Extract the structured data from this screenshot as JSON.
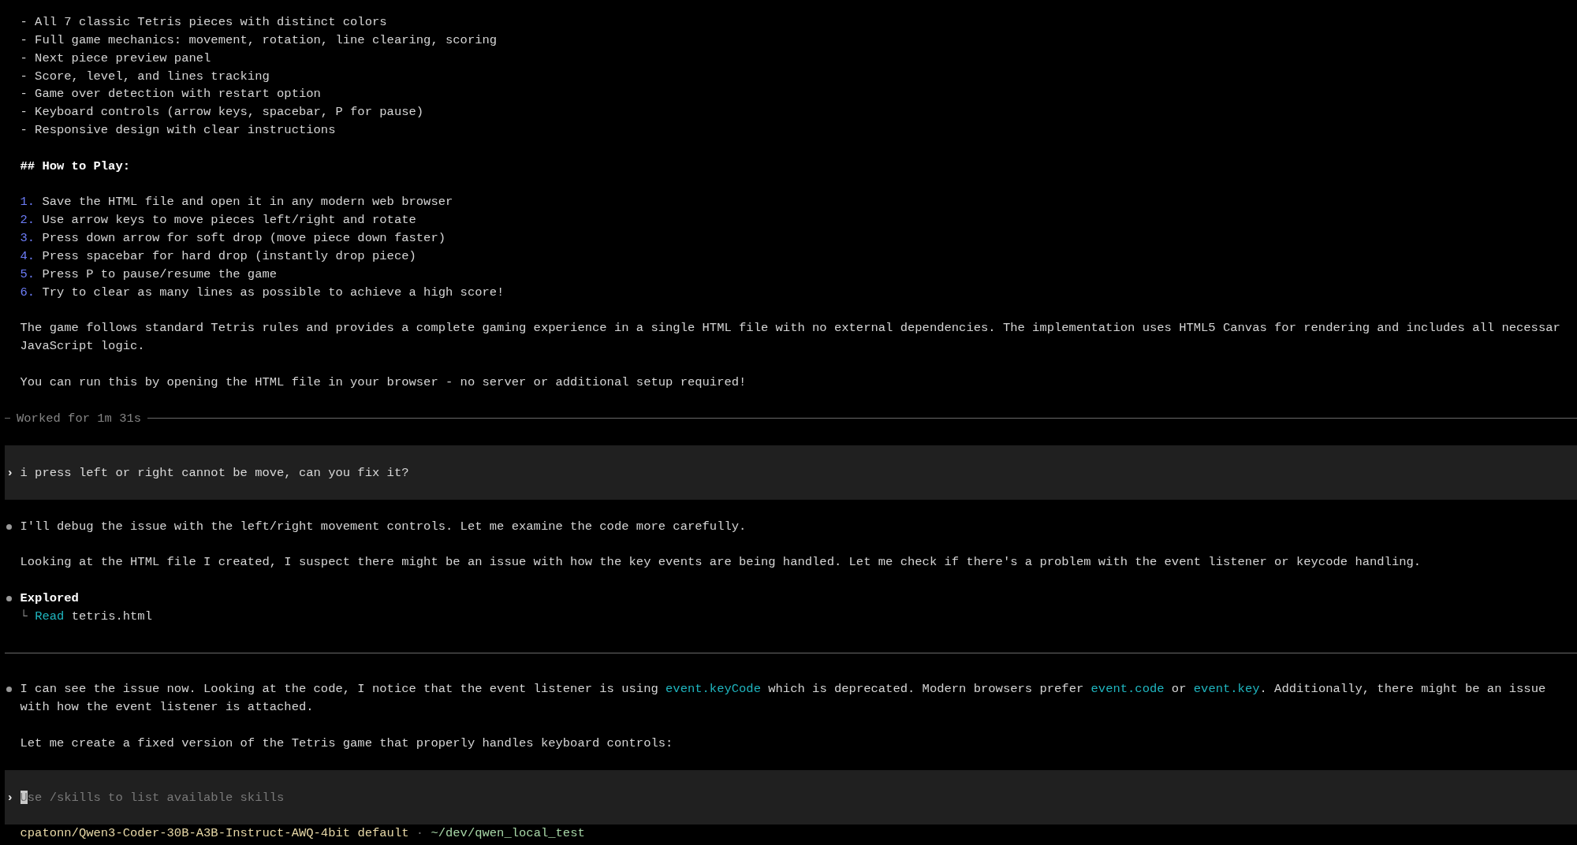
{
  "transcript": [
    {
      "kind": "bullets",
      "items": [
        "- All 7 classic Tetris pieces with distinct colors",
        "- Full game mechanics: movement, rotation, line clearing, scoring",
        "- Next piece preview panel",
        "- Score, level, and lines tracking",
        "- Game over detection with restart option",
        "- Keyboard controls (arrow keys, spacebar, P for pause)",
        "- Responsive design with clear instructions"
      ]
    },
    {
      "kind": "heading",
      "text": "## How to Play:"
    },
    {
      "kind": "numbered",
      "items": [
        {
          "number": "1.",
          "text": "Save the HTML file and open it in any modern web browser"
        },
        {
          "number": "2.",
          "text": "Use arrow keys to move pieces left/right and rotate"
        },
        {
          "number": "3.",
          "text": "Press down arrow for soft drop (move piece down faster)"
        },
        {
          "number": "4.",
          "text": "Press spacebar for hard drop (instantly drop piece)"
        },
        {
          "number": "5.",
          "text": "Press P to pause/resume the game"
        },
        {
          "number": "6.",
          "text": "Try to clear as many lines as possible to achieve a high score!"
        }
      ]
    },
    {
      "kind": "paragraph",
      "bullet": false,
      "lines": [
        [
          {
            "text": "The game follows standard Tetris rules and provides a complete gaming experience in a single HTML file with no external dependencies. The implementation uses HTML5 Canvas for rendering and includes all necessar"
          }
        ],
        [
          {
            "text": "JavaScript logic."
          }
        ]
      ]
    },
    {
      "kind": "paragraph",
      "bullet": false,
      "lines": [
        [
          {
            "text": "You can run this by opening the HTML file in your browser - no server or additional setup required!"
          }
        ]
      ]
    },
    {
      "kind": "worked",
      "text": "Worked for 1m 31s"
    },
    {
      "kind": "user",
      "chevron": "›",
      "text": "i press left or right cannot be move, can you fix it?"
    },
    {
      "kind": "paragraph",
      "bullet": true,
      "lines": [
        [
          {
            "text": "I'll debug the issue with the left/right movement controls. Let me examine the code more carefully."
          }
        ]
      ]
    },
    {
      "kind": "paragraph",
      "bullet": false,
      "lines": [
        [
          {
            "text": "Looking at the HTML file I created, I suspect there might be an issue with how the key events are being handled. Let me check if there's a problem with the event listener or keycode handling."
          }
        ]
      ]
    },
    {
      "kind": "tool",
      "title": "Explored",
      "calls": [
        {
          "branch": "└",
          "action": "Read",
          "target": "tetris.html"
        }
      ]
    },
    {
      "kind": "rule"
    },
    {
      "kind": "paragraph",
      "bullet": true,
      "lines": [
        [
          {
            "text": "I can see the issue now. Looking at the code, I notice that the event listener is using "
          },
          {
            "text": "event.keyCode",
            "code": true
          },
          {
            "text": " which is deprecated. Modern browsers prefer "
          },
          {
            "text": "event.code",
            "code": true
          },
          {
            "text": " or "
          },
          {
            "text": "event.key",
            "code": true
          },
          {
            "text": ". Additionally, there might be an issue"
          }
        ],
        [
          {
            "text": "with how the event listener is attached."
          }
        ]
      ]
    },
    {
      "kind": "paragraph",
      "bullet": false,
      "lines": [
        [
          {
            "text": "Let me create a fixed version of the Tetris game that properly handles keyboard controls:"
          }
        ]
      ]
    }
  ],
  "composer": {
    "chevron": "›",
    "placeholder": "Use /skills to list available skills"
  },
  "status_bar": {
    "model": "cpatonn/Qwen3-Coder-30B-A3B-Instruct-AWQ-4bit",
    "mode": "default",
    "separator": "·",
    "path": "~/dev/qwen_local_test"
  }
}
